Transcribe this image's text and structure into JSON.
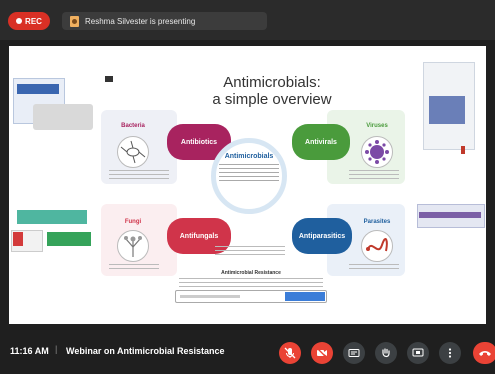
{
  "header": {
    "rec_label": "REC",
    "presenting_text": "Reshma Silvester is presenting"
  },
  "slide": {
    "title_line1": "Antimicrobials:",
    "title_line2": "a simple overview",
    "center_title": "Antimicrobials",
    "antibiotics": "Antibiotics",
    "antivirals": "Antivirals",
    "antifungals": "Antifungals",
    "antiparasitics": "Antiparasitics",
    "bacteria": "Bacteria",
    "viruses": "Viruses",
    "fungi": "Fungi",
    "parasites": "Parasites",
    "amr_title": "Antimicrobial Resistance"
  },
  "footer": {
    "time": "11:16 AM",
    "separator": "|",
    "meeting_title": "Webinar on Antimicrobial Resistance"
  },
  "colors": {
    "rec_red": "#d93025",
    "antibiotics": "#a8235f",
    "antivirals": "#4a9b3c",
    "antifungals": "#d0344a",
    "antiparasitics": "#1f5f9e",
    "end_call": "#ea4335"
  },
  "icons": [
    "rec-dot-icon",
    "presentation-icon",
    "mic-off-icon",
    "camera-off-icon",
    "captions-icon",
    "raise-hand-icon",
    "present-screen-icon",
    "more-options-icon",
    "end-call-icon"
  ]
}
